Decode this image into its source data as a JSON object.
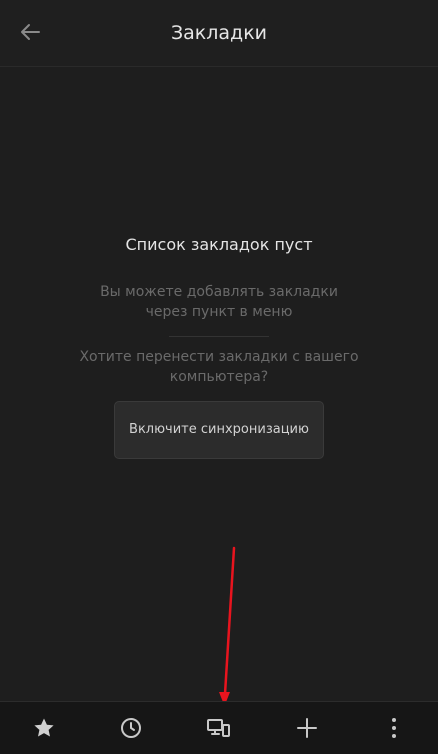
{
  "header": {
    "title": "Закладки",
    "back_icon": "arrow-left-icon"
  },
  "empty_state": {
    "title": "Список закладок пуст",
    "hint": "Вы можете добавлять закладки через пункт в меню",
    "question": "Хотите перенести закладки с вашего компьютера?",
    "sync_button_label": "Включите синхронизацию"
  },
  "toolbar": {
    "items": [
      {
        "icon": "star-icon"
      },
      {
        "icon": "clock-icon"
      },
      {
        "icon": "devices-icon"
      },
      {
        "icon": "plus-icon"
      },
      {
        "icon": "more-vertical-icon"
      }
    ]
  },
  "colors": {
    "background": "#1e1e1e",
    "toolbar": "#161616",
    "annotation_arrow": "#e8141e"
  }
}
